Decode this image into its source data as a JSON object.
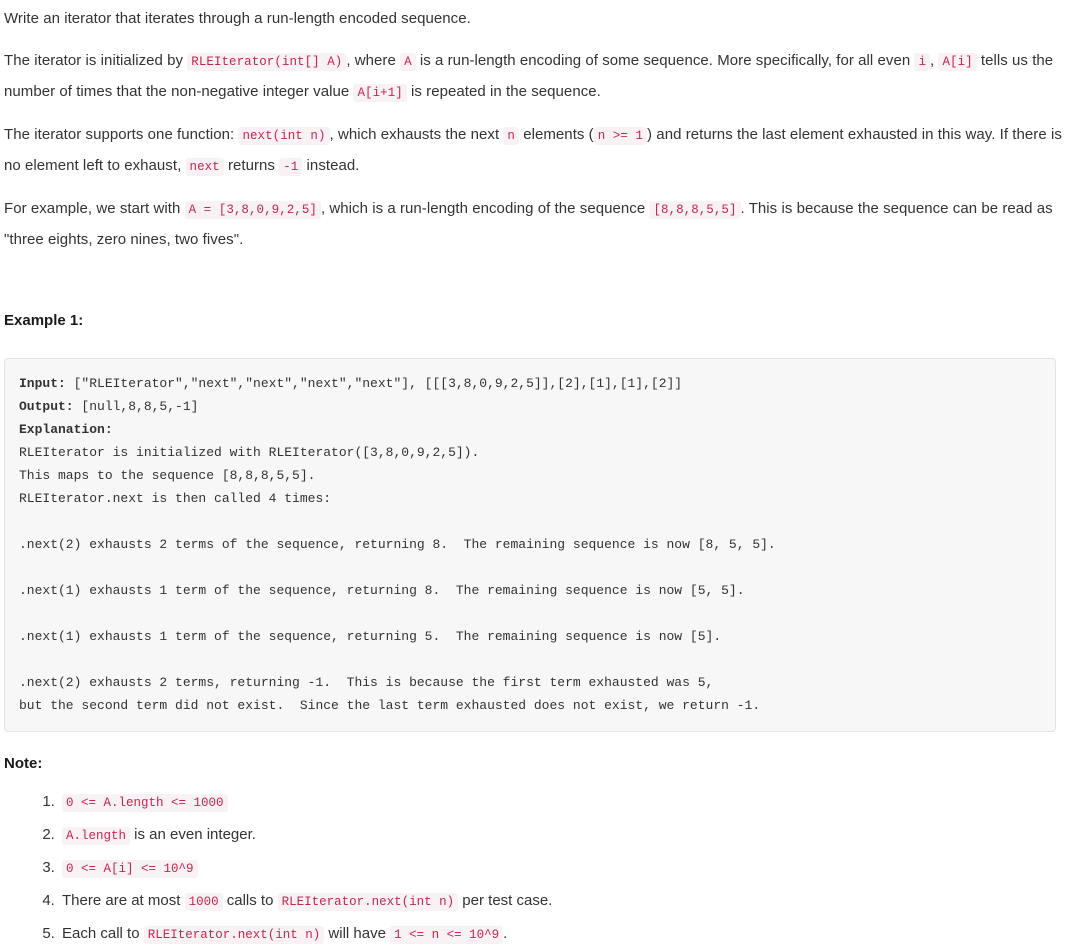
{
  "problem": {
    "paragraphs": [
      {
        "id": "p1",
        "parts": [
          {
            "type": "text",
            "value": "Write an iterator that iterates through a run-length encoded sequence."
          }
        ]
      },
      {
        "id": "p2",
        "parts": [
          {
            "type": "text",
            "value": "The iterator is initialized by "
          },
          {
            "type": "code",
            "value": "RLEIterator(int[] A)"
          },
          {
            "type": "text",
            "value": ", where "
          },
          {
            "type": "code",
            "value": "A"
          },
          {
            "type": "text",
            "value": " is a run-length encoding of some sequence.  More specifically, for all even "
          },
          {
            "type": "code",
            "value": "i"
          },
          {
            "type": "text",
            "value": ", "
          },
          {
            "type": "code",
            "value": "A[i]"
          },
          {
            "type": "text",
            "value": " tells us the number of times that the non-negative integer value "
          },
          {
            "type": "code",
            "value": "A[i+1]"
          },
          {
            "type": "text",
            "value": " is repeated in the sequence."
          }
        ]
      },
      {
        "id": "p3",
        "parts": [
          {
            "type": "text",
            "value": "The iterator supports one function: "
          },
          {
            "type": "code",
            "value": "next(int n)"
          },
          {
            "type": "text",
            "value": ", which exhausts the next "
          },
          {
            "type": "code",
            "value": "n"
          },
          {
            "type": "text",
            "value": " elements ("
          },
          {
            "type": "code",
            "value": "n >= 1"
          },
          {
            "type": "text",
            "value": ") and returns the last element exhausted in this way.  If there is no element left to exhaust, "
          },
          {
            "type": "code",
            "value": "next"
          },
          {
            "type": "text",
            "value": " returns "
          },
          {
            "type": "code",
            "value": "-1"
          },
          {
            "type": "text",
            "value": " instead."
          }
        ]
      },
      {
        "id": "p4",
        "parts": [
          {
            "type": "text",
            "value": "For example, we start with "
          },
          {
            "type": "code",
            "value": "A = [3,8,0,9,2,5]"
          },
          {
            "type": "text",
            "value": ", which is a run-length encoding of the sequence "
          },
          {
            "type": "code",
            "value": "[8,8,8,5,5]"
          },
          {
            "type": "text",
            "value": ".  This is because the sequence can be read as \"three eights, zero nines, two fives\"."
          }
        ]
      }
    ],
    "example": {
      "heading": "Example 1:",
      "code_lines": [
        {
          "label": "Input: ",
          "value": "[\"RLEIterator\",\"next\",\"next\",\"next\",\"next\"], [[[3,8,0,9,2,5]],[2],[1],[1],[2]]"
        },
        {
          "label": "Output: ",
          "value": "[null,8,8,5,-1]"
        },
        {
          "label": "Explanation:",
          "value": ""
        },
        {
          "label": "",
          "value": "RLEIterator is initialized with RLEIterator([3,8,0,9,2,5])."
        },
        {
          "label": "",
          "value": "This maps to the sequence [8,8,8,5,5]."
        },
        {
          "label": "",
          "value": "RLEIterator.next is then called 4 times:"
        },
        {
          "label": "",
          "value": ""
        },
        {
          "label": "",
          "value": ".next(2) exhausts 2 terms of the sequence, returning 8.  The remaining sequence is now [8, 5, 5]."
        },
        {
          "label": "",
          "value": ""
        },
        {
          "label": "",
          "value": ".next(1) exhausts 1 term of the sequence, returning 8.  The remaining sequence is now [5, 5]."
        },
        {
          "label": "",
          "value": ""
        },
        {
          "label": "",
          "value": ".next(1) exhausts 1 term of the sequence, returning 5.  The remaining sequence is now [5]."
        },
        {
          "label": "",
          "value": ""
        },
        {
          "label": "",
          "value": ".next(2) exhausts 2 terms, returning -1.  This is because the first term exhausted was 5,"
        },
        {
          "label": "",
          "value": "but the second term did not exist.  Since the last term exhausted does not exist, we return -1."
        }
      ]
    },
    "note": {
      "heading": "Note:",
      "items": [
        {
          "parts": [
            {
              "type": "code",
              "value": "0 <= A.length <= 1000"
            }
          ]
        },
        {
          "parts": [
            {
              "type": "code",
              "value": "A.length"
            },
            {
              "type": "text",
              "value": " is an even integer."
            }
          ]
        },
        {
          "parts": [
            {
              "type": "code",
              "value": "0 <= A[i] <= 10^9"
            }
          ]
        },
        {
          "parts": [
            {
              "type": "text",
              "value": "There are at most "
            },
            {
              "type": "code",
              "value": "1000"
            },
            {
              "type": "text",
              "value": " calls to "
            },
            {
              "type": "code",
              "value": "RLEIterator.next(int n)"
            },
            {
              "type": "text",
              "value": " per test case."
            }
          ]
        },
        {
          "parts": [
            {
              "type": "text",
              "value": "Each call to "
            },
            {
              "type": "code",
              "value": "RLEIterator.next(int n)"
            },
            {
              "type": "text",
              "value": " will have "
            },
            {
              "type": "code",
              "value": "1 <= n <= 10^9"
            },
            {
              "type": "text",
              "value": "."
            }
          ]
        }
      ]
    }
  },
  "theme": {
    "inline_code_color": "#c7254e",
    "inline_code_bg": "#f9f2f4",
    "code_block_bg": "#f7f7f7",
    "code_block_border": "#e3e3e3",
    "text_color": "#333333",
    "heading_color": "#1a1a1a"
  }
}
